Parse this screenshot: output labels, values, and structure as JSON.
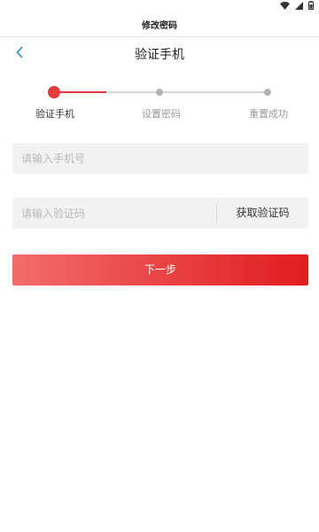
{
  "header": {
    "window_title": "修改密码",
    "page_title": "验证手机"
  },
  "steps": [
    {
      "label": "验证手机",
      "active": true
    },
    {
      "label": "设置密码",
      "active": false
    },
    {
      "label": "重置成功",
      "active": false
    }
  ],
  "form": {
    "phone_placeholder": "请输入手机号",
    "code_placeholder": "请输入验证码",
    "get_code_label": "获取验证码",
    "next_label": "下一步"
  },
  "colors": {
    "accent": "#e33b3f",
    "button_gradient_start": "#f36c6c",
    "button_gradient_end": "#e01c1f",
    "inactive": "#b4b4b4"
  },
  "icons": {
    "back": "chevron-left-icon",
    "wifi": "wifi-icon",
    "signal": "signal-icon",
    "battery": "battery-icon"
  }
}
